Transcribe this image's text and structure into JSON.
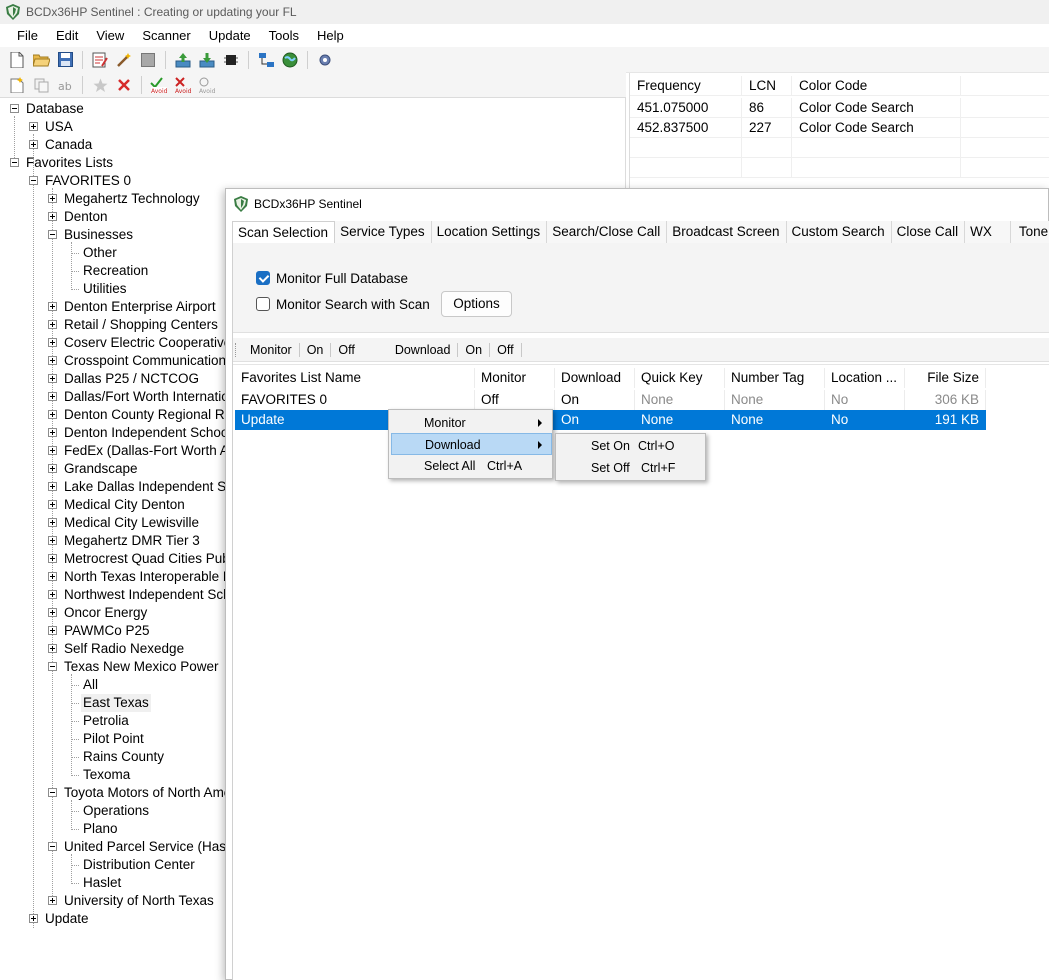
{
  "window": {
    "title": "BCDx36HP Sentinel : Creating or updating your FL"
  },
  "menu": [
    "File",
    "Edit",
    "View",
    "Scanner",
    "Update",
    "Tools",
    "Help"
  ],
  "tree": {
    "database": "Database",
    "usa": "USA",
    "canada": "Canada",
    "favorites_lists": "Favorites Lists",
    "favorites0": "FAVORITES 0",
    "items": [
      "Megahertz Technology",
      "Denton",
      "Businesses",
      "Other",
      "Recreation",
      "Utilities",
      "Denton Enterprise Airport",
      "Retail / Shopping Centers",
      "Coserv Electric Cooperative",
      "Crosspoint Communications",
      "Dallas P25 / NCTCOG",
      "Dallas/Fort Worth Internation",
      "Denton County Regional Ra",
      "Denton Independent School",
      "FedEx (Dallas-Fort Worth A",
      "Grandscape",
      "Lake Dallas Independent Sc",
      "Medical City Denton",
      "Medical City Lewisville",
      "Megahertz DMR Tier 3",
      "Metrocrest Quad Cities Pub",
      "North Texas Interoperable R",
      "Northwest Independent Scho",
      "Oncor Energy",
      "PAWMCo P25",
      "Self Radio Nexedge",
      "Texas New Mexico Power",
      "All",
      "East Texas",
      "Petrolia",
      "Pilot Point",
      "Rains County",
      "Texoma",
      "Toyota Motors of North Ame",
      "Operations",
      "Plano",
      "United Parcel Service (Hasle",
      "Distribution Center",
      "Haslet",
      "University of North Texas"
    ],
    "update": "Update"
  },
  "freq_grid": {
    "headers": [
      "Frequency",
      "LCN",
      "Color Code"
    ],
    "rows": [
      [
        "451.075000",
        "86",
        "Color Code Search"
      ],
      [
        "452.837500",
        "227",
        "Color Code Search"
      ]
    ]
  },
  "dialog": {
    "title": "BCDx36HP Sentinel",
    "tabs": [
      "Scan Selection",
      "Service Types",
      "Location Settings",
      "Search/Close Call",
      "Broadcast Screen",
      "Custom Search",
      "Close Call",
      "WX",
      "Tone Out"
    ],
    "monitor_full_db": "Monitor Full Database",
    "monitor_search": "Monitor Search with Scan",
    "options_btn": "Options",
    "toolbar": {
      "monitor": "Monitor",
      "on1": "On",
      "off1": "Off",
      "download": "Download",
      "on2": "On",
      "off2": "Off"
    },
    "grid_headers": [
      "Favorites List Name",
      "Monitor",
      "Download",
      "Quick Key",
      "Number Tag",
      "Location ...",
      "File Size"
    ],
    "grid_rows": [
      [
        "FAVORITES 0",
        "Off",
        "On",
        "None",
        "None",
        "No",
        "306 KB"
      ],
      [
        "Update",
        "",
        "On",
        "None",
        "None",
        "No",
        "191 KB"
      ]
    ]
  },
  "context_menu": {
    "items": [
      {
        "label": "Monitor",
        "shortcut": ""
      },
      {
        "label": "Download",
        "shortcut": ""
      },
      {
        "label": "Select All",
        "shortcut": "Ctrl+A"
      }
    ]
  },
  "submenu": {
    "items": [
      {
        "label": "Set On",
        "shortcut": "Ctrl+O"
      },
      {
        "label": "Set Off",
        "shortcut": "Ctrl+F"
      }
    ]
  }
}
